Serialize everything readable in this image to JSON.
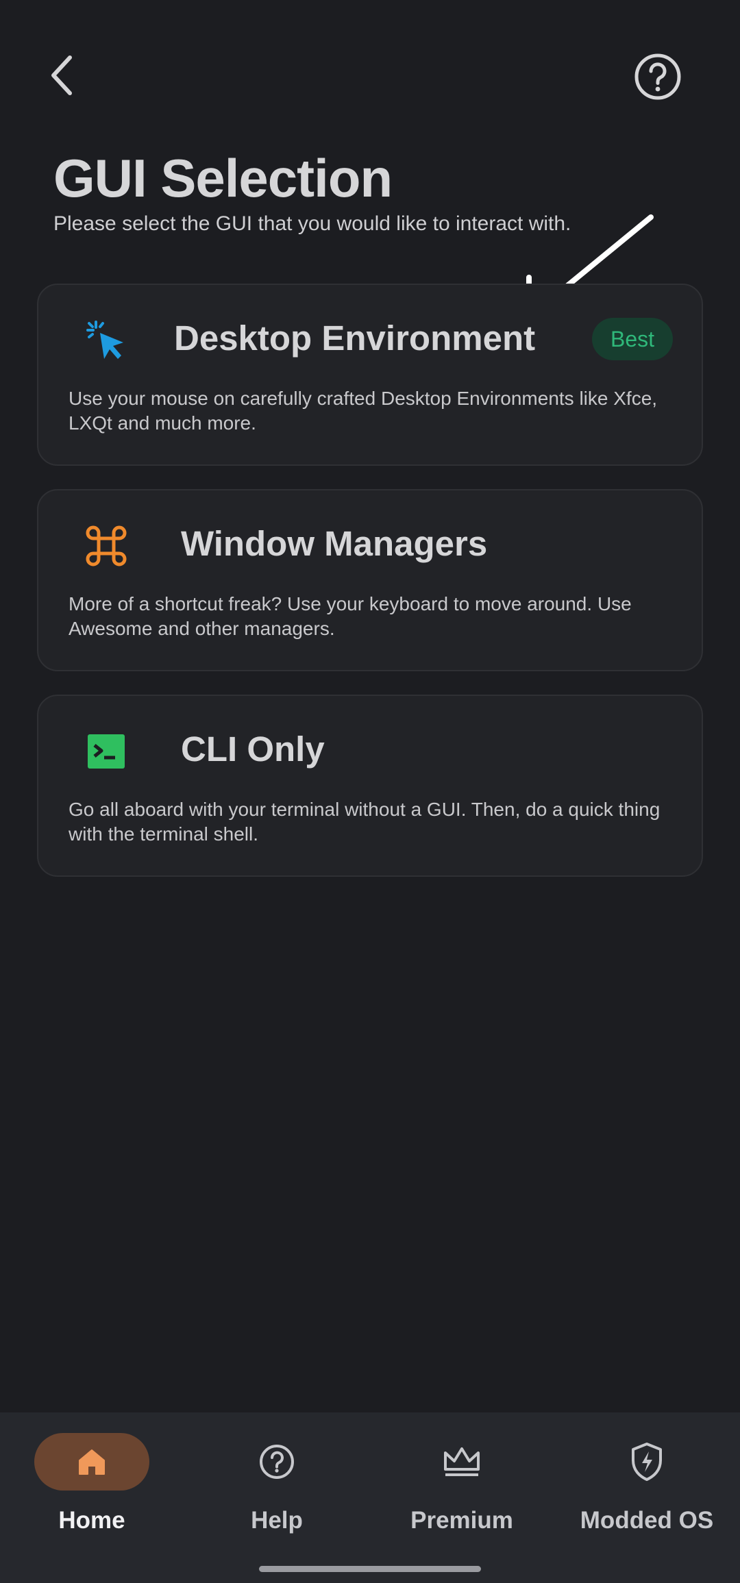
{
  "header": {
    "title": "GUI Selection",
    "subtitle": "Please select the GUI that you would like to interact with."
  },
  "cards": [
    {
      "title": "Desktop Environment",
      "description": "Use your mouse on carefully crafted Desktop Environments like Xfce, LXQt and much more.",
      "badge": "Best",
      "icon": "cursor-click-icon",
      "icon_color": "#1e9be0"
    },
    {
      "title": "Window Managers",
      "description": "More of a shortcut freak? Use your keyboard to move around. Use Awesome and other managers.",
      "icon": "command-key-icon",
      "icon_color": "#f08a2c"
    },
    {
      "title": "CLI Only",
      "description": "Go all aboard with your terminal without a GUI. Then, do a quick thing with the terminal shell.",
      "icon": "terminal-icon",
      "icon_color": "#2fbf5f"
    }
  ],
  "bottom_nav": {
    "items": [
      {
        "label": "Home",
        "icon": "home-icon",
        "active": true
      },
      {
        "label": "Help",
        "icon": "help-circle-icon",
        "active": false
      },
      {
        "label": "Premium",
        "icon": "crown-icon",
        "active": false
      },
      {
        "label": "Modded OS",
        "icon": "shield-bolt-icon",
        "active": false
      }
    ]
  },
  "colors": {
    "background": "#1c1d21",
    "card": "#222327",
    "accent_home": "#f0995a",
    "badge_text": "#2fb87a"
  }
}
